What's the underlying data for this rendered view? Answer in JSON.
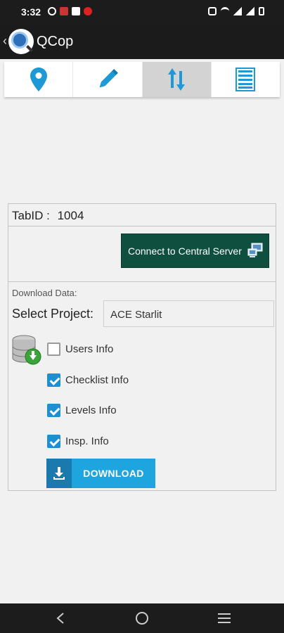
{
  "status_bar": {
    "time": "3:32"
  },
  "app_bar": {
    "back_glyph": "‹",
    "title": "QCop"
  },
  "tabs": [
    {
      "icon": "location-pin-icon",
      "active": false
    },
    {
      "icon": "pencil-icon",
      "active": false
    },
    {
      "icon": "sync-arrows-icon",
      "active": true
    },
    {
      "icon": "list-icon",
      "active": false
    }
  ],
  "card": {
    "tab_id_label": "TabID :",
    "tab_id_value": "1004",
    "connect_label": "Connect to Central Server",
    "download_data_label": "Download Data:",
    "select_project_label": "Select Project:",
    "project_value": "ACE Starlit",
    "checkboxes": [
      {
        "label": "Users Info",
        "checked": false
      },
      {
        "label": "Checklist Info",
        "checked": true
      },
      {
        "label": "Levels Info",
        "checked": true
      },
      {
        "label": "Insp. Info",
        "checked": true
      }
    ],
    "download_label": "DOWNLOAD"
  },
  "colors": {
    "accent": "#1ea5df",
    "connect_button": "#0f4f40",
    "tab_icon": "#1d9ad6"
  }
}
